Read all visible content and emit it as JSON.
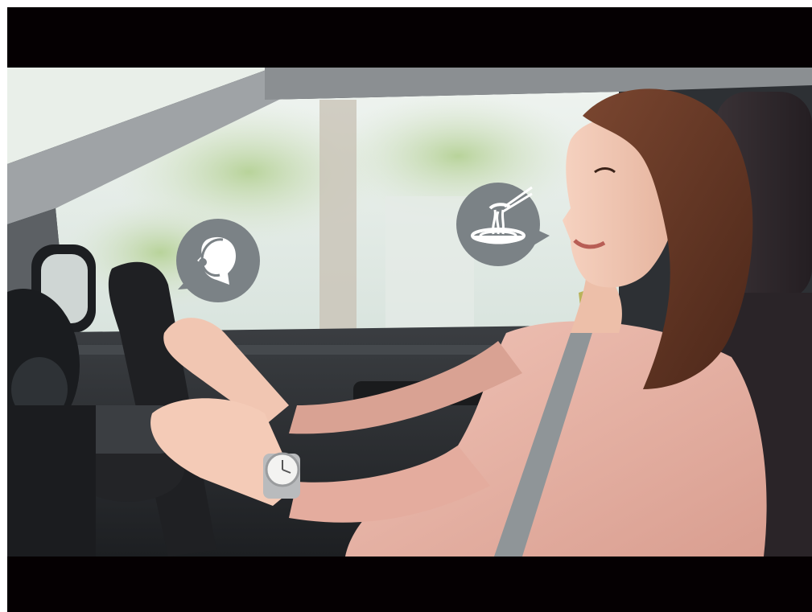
{
  "scene": {
    "subject": "woman-driving-car",
    "icons": {
      "left_bubble": "operator-headset-icon",
      "right_bubble": "noodle-bowl-icon"
    },
    "colors": {
      "letterbox": "#050002",
      "bubble_fill": "#7b8286",
      "bubble_icon": "#ffffff",
      "sweater": "#e7b3a6",
      "hair": "#6a3a28",
      "interior": "#2b2d30",
      "window_light": "#dfe9e4",
      "foliage": "#a7c48f"
    }
  }
}
